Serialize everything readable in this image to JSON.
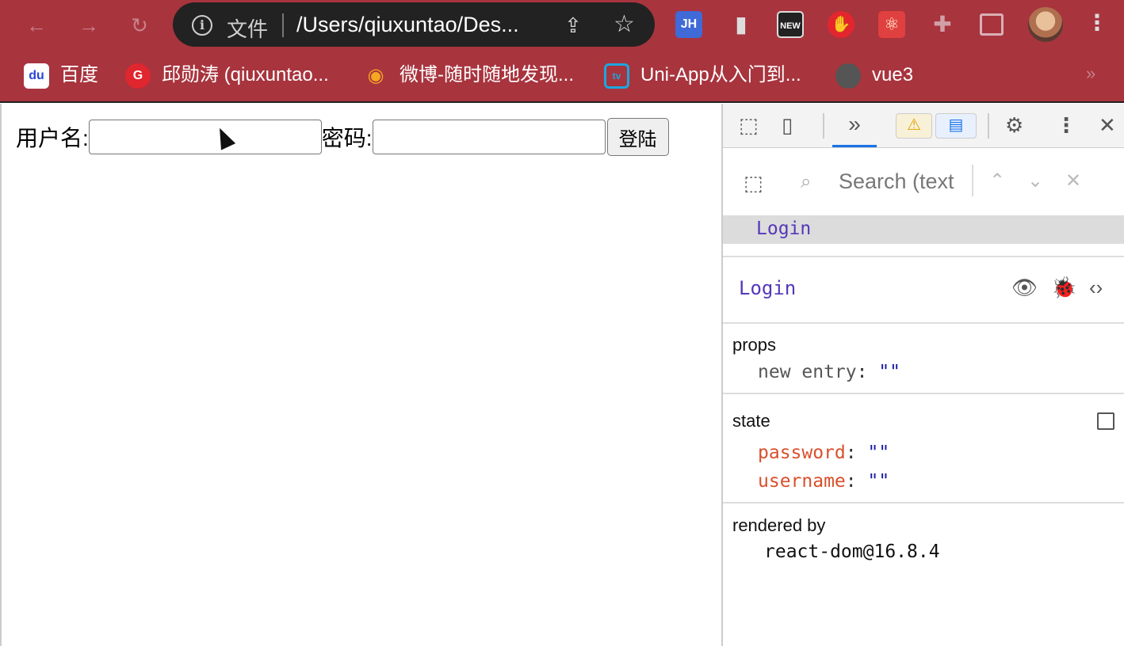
{
  "browser": {
    "omnibox": {
      "scheme": "文件",
      "url": "/Users/qiuxuntao/Des..."
    },
    "extensions": {
      "jh": "JH",
      "new": "NEW"
    }
  },
  "bookmarks": [
    {
      "label": "百度",
      "icon": "du"
    },
    {
      "label": "邱勋涛 (qiuxuntao...",
      "icon": "G"
    },
    {
      "label": "微博-随时随地发现...",
      "icon": "◉"
    },
    {
      "label": "Uni-App从入门到...",
      "icon": "tv"
    },
    {
      "label": "vue3",
      "icon": ""
    }
  ],
  "page": {
    "username_label": "用户名:",
    "password_label": "密码:",
    "username_value": "",
    "password_value": "",
    "login_label": "登陆"
  },
  "devtools": {
    "search_placeholder": "Search (text",
    "tree_selected": "Login",
    "component_name": "Login",
    "props_title": "props",
    "props": [
      {
        "key": "new entry",
        "value": "\"\""
      }
    ],
    "state_title": "state",
    "state": [
      {
        "key": "password",
        "value": "\"\""
      },
      {
        "key": "username",
        "value": "\"\""
      }
    ],
    "rendered_by_title": "rendered by",
    "renderer": "react-dom@16.8.4"
  }
}
